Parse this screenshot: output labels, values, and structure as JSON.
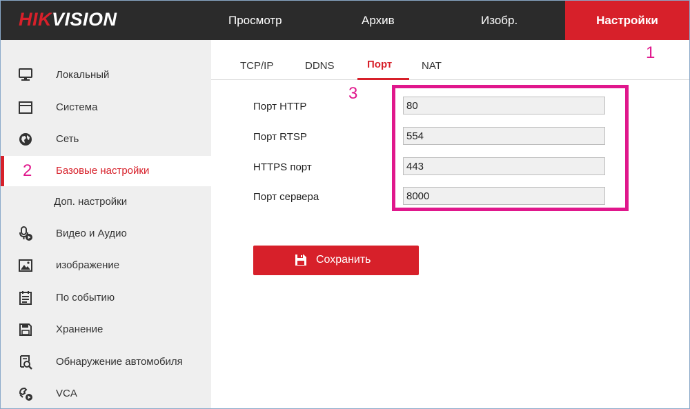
{
  "brand": {
    "part1": "HIK",
    "part2": "VISION"
  },
  "nav": [
    {
      "label": "Просмотр"
    },
    {
      "label": "Архив"
    },
    {
      "label": "Изобр."
    },
    {
      "label": "Настройки"
    }
  ],
  "sidebar": {
    "items": [
      {
        "label": "Локальный",
        "icon": "monitor-icon"
      },
      {
        "label": "Система",
        "icon": "window-icon"
      },
      {
        "label": "Сеть",
        "icon": "globe-icon"
      },
      {
        "label": "Базовые настройки",
        "icon": ""
      },
      {
        "label": "Доп. настройки",
        "icon": ""
      },
      {
        "label": "Видео и Аудио",
        "icon": "microphone-camera-icon"
      },
      {
        "label": "изображение",
        "icon": "image-icon"
      },
      {
        "label": "По событию",
        "icon": "calendar-icon"
      },
      {
        "label": "Хранение",
        "icon": "floppy-icon"
      },
      {
        "label": "Обнаружение автомобиля",
        "icon": "vehicle-search-icon"
      },
      {
        "label": "VCA",
        "icon": "vca-icon"
      }
    ]
  },
  "tabs": [
    {
      "label": "TCP/IP"
    },
    {
      "label": "DDNS"
    },
    {
      "label": "Порт"
    },
    {
      "label": "NAT"
    }
  ],
  "fields": [
    {
      "label": "Порт HTTP",
      "value": "80"
    },
    {
      "label": "Порт RTSP",
      "value": "554"
    },
    {
      "label": "HTTPS порт",
      "value": "443"
    },
    {
      "label": "Порт сервера",
      "value": "8000"
    }
  ],
  "save_label": "Сохранить",
  "annotations": {
    "a1": "1",
    "a2": "2",
    "a3": "3"
  },
  "colors": {
    "accent": "#d7202a",
    "annotation": "#e0178c",
    "header_bg": "#2b2b2b",
    "sidebar_bg": "#efefef"
  }
}
